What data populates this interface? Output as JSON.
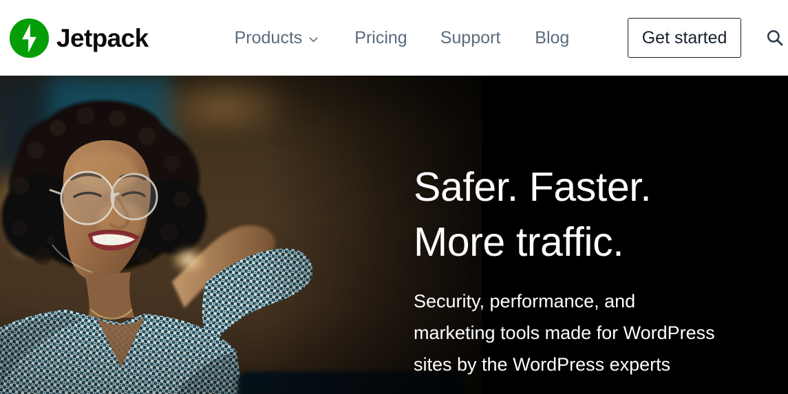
{
  "header": {
    "brand": {
      "name": "Jetpack",
      "logo_icon": "jetpack-logo-icon",
      "logo_color": "#069e08"
    },
    "nav": [
      {
        "label": "Products",
        "has_dropdown": true,
        "dropdown_icon": "chevron-down-icon"
      },
      {
        "label": "Pricing",
        "has_dropdown": false
      },
      {
        "label": "Support",
        "has_dropdown": false
      },
      {
        "label": "Blog",
        "has_dropdown": false
      }
    ],
    "cta_label": "Get started",
    "search_icon": "search-icon",
    "nav_text_color": "#5b6b7c",
    "background": "#ffffff"
  },
  "hero": {
    "headline_line1": "Safer. Faster.",
    "headline_line2": "More traffic.",
    "subtext_line1": "Security, performance, and",
    "subtext_line2": "marketing tools made for WordPress",
    "subtext_line3": "sites by the WordPress experts",
    "text_color": "#ffffff",
    "background_color": "#000000",
    "image_alt": "Smiling woman with curly hair and round glasses, hands behind her head, wearing a patterned shirt"
  }
}
